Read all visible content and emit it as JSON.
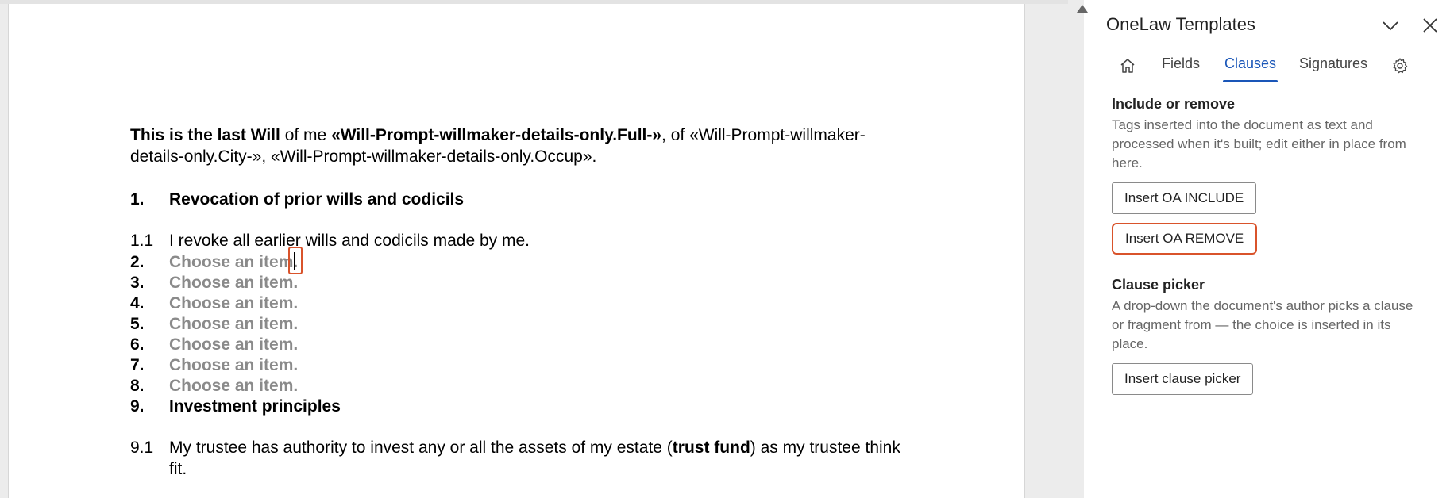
{
  "document": {
    "intro": {
      "p1_bold": "This is the last Will",
      "p2": " of me ",
      "p3_bold": "«Will-Prompt-willmaker-details-only.Full-»",
      "p4": ", of «Will-Prompt-willmaker-",
      "line2": "details-only.City-», «Will-Prompt-willmaker-details-only.Occup»."
    },
    "sections": [
      {
        "num": "1.",
        "text": "Revocation of prior wills and codicils"
      },
      {
        "num": "1.1",
        "text": "I revoke all earlier wills and codicils made by me."
      },
      {
        "num": "2.",
        "text": "Choose an item."
      },
      {
        "num": "3.",
        "text": "Choose an item."
      },
      {
        "num": "4.",
        "text": "Choose an item."
      },
      {
        "num": "5.",
        "text": "Choose an item."
      },
      {
        "num": "6.",
        "text": "Choose an item."
      },
      {
        "num": "7.",
        "text": "Choose an item."
      },
      {
        "num": "8.",
        "text": "Choose an item."
      },
      {
        "num": "9.",
        "text": "Investment principles"
      }
    ],
    "clause_9_1": {
      "num": "9.1",
      "before": "My trustee has authority to invest any or all the assets of my estate (",
      "bold": "trust fund",
      "after": ") as my trustee think",
      "line2": "fit."
    }
  },
  "panel": {
    "title": "OneLaw Templates",
    "tabs": {
      "home_icon": "home-icon",
      "fields": "Fields",
      "clauses": "Clauses",
      "signatures": "Signatures",
      "settings_icon": "gear-icon"
    },
    "active_tab": "Clauses",
    "include_remove": {
      "heading": "Include or remove",
      "desc_line1": "Tags inserted into the document as text and",
      "desc_line2": "processed when it's built; edit either in place from",
      "desc_line3": "here.",
      "btn_include": "Insert OA INCLUDE",
      "btn_remove": "Insert OA REMOVE"
    },
    "clause_picker": {
      "heading": "Clause picker",
      "desc_line1": "A drop-down the document's author picks a clause",
      "desc_line2": "or fragment from — the choice is inserted in its",
      "desc_line3": "place.",
      "btn": "Insert clause picker"
    }
  },
  "colors": {
    "accent": "#1a56b8",
    "focus_outline": "#d9532b",
    "placeholder_text": "#8a8a8a"
  }
}
